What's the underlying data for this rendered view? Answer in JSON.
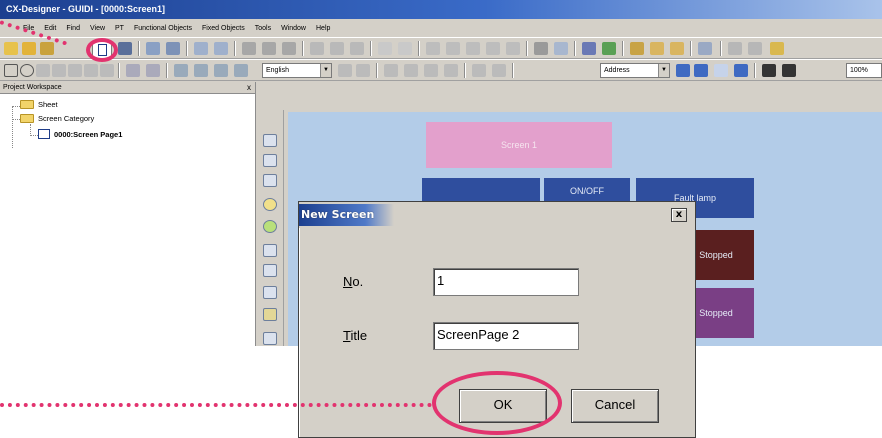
{
  "window": {
    "title": "CX-Designer - GUIDI - [0000:Screen1]"
  },
  "menu": {
    "items": [
      "File",
      "Edit",
      "Find",
      "View",
      "PT",
      "Functional Objects",
      "Fixed Objects",
      "Tools",
      "Window",
      "Help"
    ]
  },
  "toolbar": {
    "language_select": "English",
    "address_select": "Address",
    "zoom": "100%"
  },
  "workspace": {
    "title": "Project Workspace",
    "close": "x",
    "tree": {
      "sheet": "Sheet",
      "category": "Screen Category",
      "page": "0000:Screen Page1"
    }
  },
  "canvas": {
    "screen_label": "Screen 1",
    "buttons": [
      "ON/OFF",
      "Fault lamp"
    ],
    "status": [
      "Stopped",
      "Stopped"
    ]
  },
  "dialog": {
    "title": "New Screen",
    "close": "x",
    "no_label_u": "N",
    "no_label_rest": "o.",
    "no_value": "1",
    "title_label_u": "T",
    "title_label_rest": "itle",
    "title_value": "ScreenPage 2",
    "ok_label": "OK",
    "cancel_label": "Cancel"
  },
  "colors": {
    "annotation": "#e2336f",
    "canvas_bg": "#b3cce8",
    "screen_header": "#e3a0cc",
    "object_blue": "#2f4e9e",
    "brown_lamp": "#5a1f1f",
    "purple_lamp": "#7a3f85"
  }
}
